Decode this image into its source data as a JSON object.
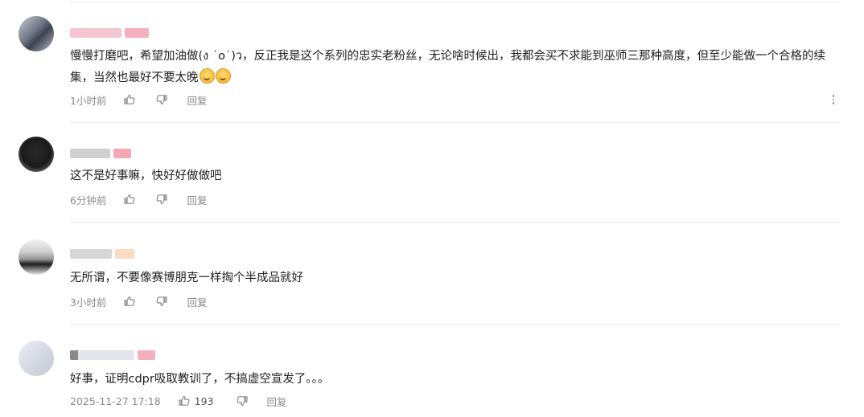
{
  "comments": [
    {
      "text": "慢慢打磨吧，希望加油做(ง ˙o˙)ว，反正我是这个系列的忠实老粉丝，无论啥时候出，我都会买不求能到巫师三那种高度，但至少能做一个合格的续集，当然也最好不要太晚",
      "emoji_icons": [
        "laughing-tears-emoji",
        "laughing-tears-emoji"
      ],
      "time": "1小时前",
      "like_count": "",
      "reply_label": "回复"
    },
    {
      "text": "这不是好事嘛，快好好做做吧",
      "time": "6分钟前",
      "like_count": "",
      "reply_label": "回复"
    },
    {
      "text": "无所谓，不要像赛博朋克一样掏个半成品就好",
      "time": "3小时前",
      "like_count": "",
      "reply_label": "回复"
    },
    {
      "text": "好事，证明cdpr吸取教训了，不搞虚空宣发了。。。",
      "time": "2025-11-27 17:18",
      "like_count": "193",
      "reply_label": "回复"
    }
  ],
  "colors": {
    "text": "#1f1f1f",
    "meta": "#8a8a8a",
    "divider": "#ebebeb",
    "name_blur": "#f4b6c2"
  },
  "icons": {
    "like": "thumbs-up-icon",
    "dislike": "thumbs-down-icon",
    "more": "more-vertical-icon"
  }
}
